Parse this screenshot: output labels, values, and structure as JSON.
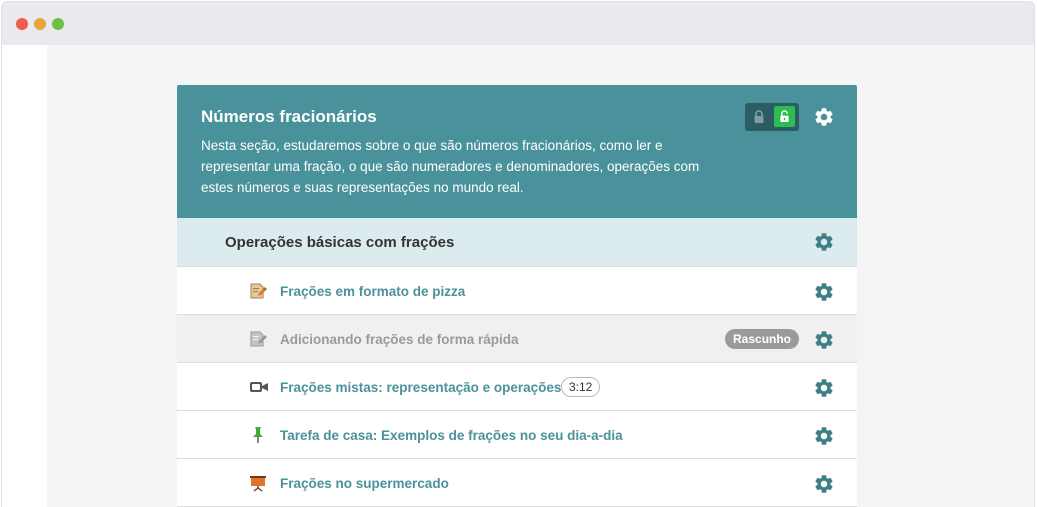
{
  "section": {
    "title": "Números fracionários",
    "description": "Nesta seção, estudaremos sobre o que são números fracionários, como ler e representar uma fração, o que são numeradores e denominadores, operações com estes números e suas representações no mundo real."
  },
  "subsection": {
    "title": "Operações básicas com frações"
  },
  "items": [
    {
      "title": "Frações em formato de pizza",
      "icon": "edit-document-icon"
    },
    {
      "title": "Adicionando frações de forma rápida",
      "icon": "edit-document-icon",
      "badge": "Rascunho"
    },
    {
      "title": "Frações mistas: representação e operações",
      "icon": "video-camera-icon",
      "duration": "3:12"
    },
    {
      "title": "Tarefa de casa: Exemplos de frações no seu dia-a-dia",
      "icon": "pushpin-icon"
    },
    {
      "title": "Frações no supermercado",
      "icon": "presentation-board-icon"
    }
  ],
  "colors": {
    "header": "#4a929b",
    "subheader": "#dcebed",
    "link": "#4a929b",
    "lock_active": "#2dbd4e",
    "badge": "#9a9a9a"
  }
}
